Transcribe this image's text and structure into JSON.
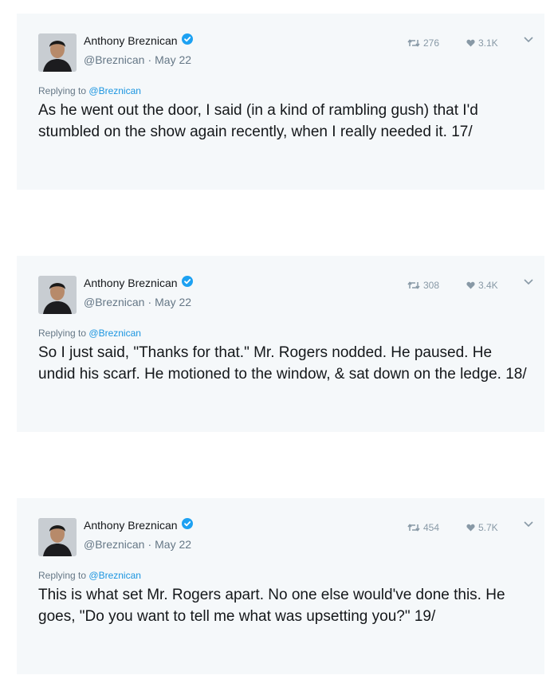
{
  "accent_color": "#1b95e0",
  "tweets": [
    {
      "author": "Anthony Breznican",
      "handle": "@Breznican",
      "date": "May 22",
      "retweets": "276",
      "likes": "3.1K",
      "replying_prefix": "Replying to",
      "replying_to": "@Breznican",
      "text": "As he went out the door, I said (in a kind of rambling gush) that I'd stumbled on the show again recently, when I really needed it. 17/"
    },
    {
      "author": "Anthony Breznican",
      "handle": "@Breznican",
      "date": "May 22",
      "retweets": "308",
      "likes": "3.4K",
      "replying_prefix": "Replying to",
      "replying_to": "@Breznican",
      "text": "So I just said, \"Thanks for that.\" Mr. Rogers nodded. He paused. He undid his scarf. He motioned to the window, & sat down on the ledge. 18/"
    },
    {
      "author": "Anthony Breznican",
      "handle": "@Breznican",
      "date": "May 22",
      "retweets": "454",
      "likes": "5.7K",
      "replying_prefix": "Replying to",
      "replying_to": "@Breznican",
      "text": "This is what set Mr. Rogers apart. No one else would've done this. He goes, \"Do you want to tell me what was upsetting you?\" 19/"
    }
  ],
  "separator": "·"
}
